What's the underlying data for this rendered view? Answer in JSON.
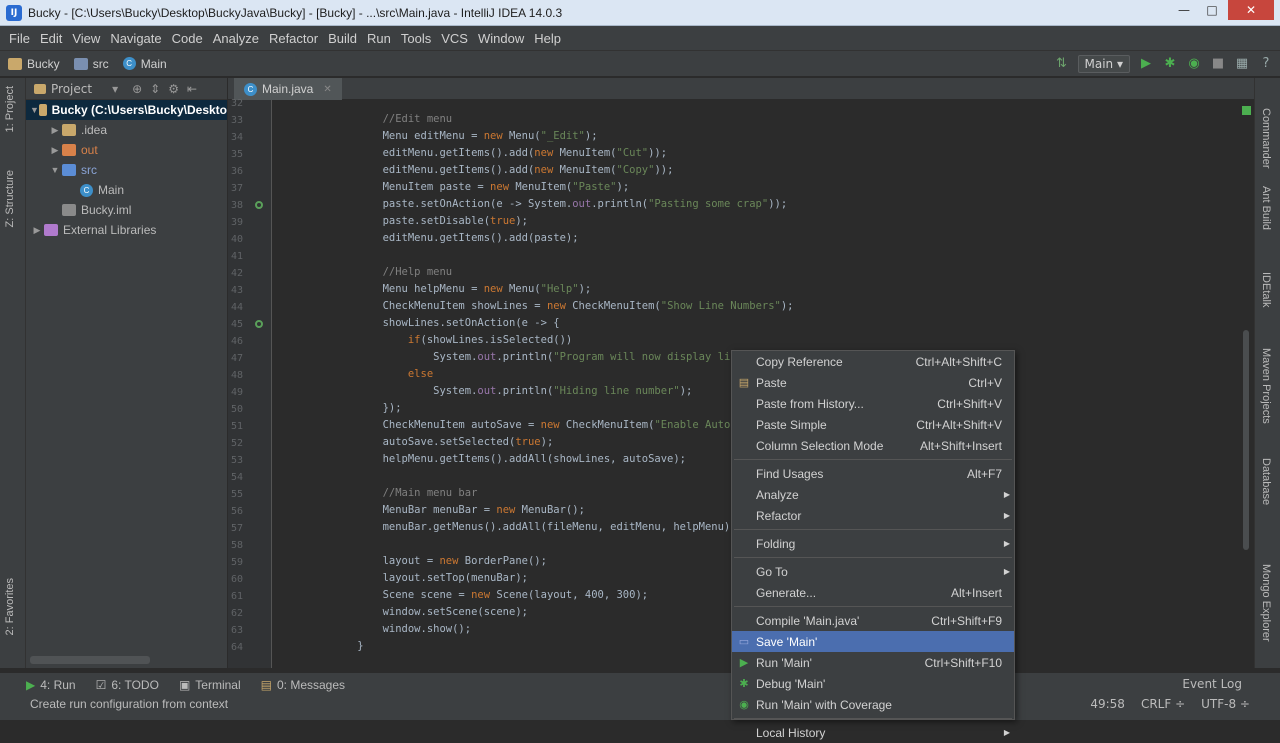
{
  "window": {
    "title": "Bucky - [C:\\Users\\Bucky\\Desktop\\BuckyJava\\Bucky] - [Bucky] - ...\\src\\Main.java - IntelliJ IDEA 14.0.3"
  },
  "menubar": [
    "File",
    "Edit",
    "View",
    "Navigate",
    "Code",
    "Analyze",
    "Refactor",
    "Build",
    "Run",
    "Tools",
    "VCS",
    "Window",
    "Help"
  ],
  "breadcrumbs": [
    "Bucky",
    "src",
    "Main"
  ],
  "run_config": "Main",
  "project_panel": {
    "title": "Project",
    "tree": [
      {
        "label": "Bucky (C:\\Users\\Bucky\\Deskto",
        "indent": 0,
        "arrow": "▼",
        "icon": "module",
        "selected": true
      },
      {
        "label": ".idea",
        "indent": 1,
        "arrow": "▶",
        "icon": "folder"
      },
      {
        "label": "out",
        "indent": 1,
        "arrow": "▶",
        "icon": "folder-orange"
      },
      {
        "label": "src",
        "indent": 1,
        "arrow": "▼",
        "icon": "folder-blue"
      },
      {
        "label": "Main",
        "indent": 2,
        "arrow": "",
        "icon": "class"
      },
      {
        "label": "Bucky.iml",
        "indent": 1,
        "arrow": "",
        "icon": "file"
      },
      {
        "label": "External Libraries",
        "indent": 0,
        "arrow": "▶",
        "icon": "library"
      }
    ]
  },
  "left_tabs": [
    "1: Project",
    "Z: Structure",
    "2: Favorites"
  ],
  "right_tabs": [
    "Commander",
    "Ant Build",
    "IDEtalk",
    "Maven Projects",
    "Database",
    "Mongo Explorer"
  ],
  "editor": {
    "tab": "Main.java",
    "first_line": 32,
    "lines": [
      [],
      [
        [
          "cm",
          "        //Edit menu"
        ]
      ],
      [
        [
          "",
          "        Menu editMenu = "
        ],
        [
          "kw",
          "new "
        ],
        [
          "",
          "Menu("
        ],
        [
          "str",
          "\"_Edit\""
        ],
        [
          "",
          ");"
        ]
      ],
      [
        [
          "",
          "        editMenu.getItems().add("
        ],
        [
          "kw",
          "new "
        ],
        [
          "",
          "MenuItem("
        ],
        [
          "str",
          "\"Cut\""
        ],
        [
          "",
          "));"
        ]
      ],
      [
        [
          "",
          "        editMenu.getItems().add("
        ],
        [
          "kw",
          "new "
        ],
        [
          "",
          "MenuItem("
        ],
        [
          "str",
          "\"Copy\""
        ],
        [
          "",
          "));"
        ]
      ],
      [
        [
          "",
          "        MenuItem paste = "
        ],
        [
          "kw",
          "new "
        ],
        [
          "",
          "MenuItem("
        ],
        [
          "str",
          "\"Paste\""
        ],
        [
          "",
          ");"
        ]
      ],
      [
        [
          "",
          "        paste.setOnAction(e -> System."
        ],
        [
          "fld",
          "out"
        ],
        [
          "",
          ".println("
        ],
        [
          "str",
          "\"Pasting some crap\""
        ],
        [
          "",
          "));"
        ]
      ],
      [
        [
          "",
          "        paste.setDisable("
        ],
        [
          "kw",
          "true"
        ],
        [
          "",
          ");"
        ]
      ],
      [
        [
          "",
          "        editMenu.getItems().add(paste);"
        ]
      ],
      [],
      [
        [
          "cm",
          "        //Help menu"
        ]
      ],
      [
        [
          "",
          "        Menu helpMenu = "
        ],
        [
          "kw",
          "new "
        ],
        [
          "",
          "Menu("
        ],
        [
          "str",
          "\"Help\""
        ],
        [
          "",
          ");"
        ]
      ],
      [
        [
          "",
          "        CheckMenuItem showLines = "
        ],
        [
          "kw",
          "new "
        ],
        [
          "",
          "CheckMenuItem("
        ],
        [
          "str",
          "\"Show Line Numbers\""
        ],
        [
          "",
          ");"
        ]
      ],
      [
        [
          "",
          "        showLines.setOnAction(e -> {"
        ]
      ],
      [
        [
          "",
          "            "
        ],
        [
          "kw",
          "if"
        ],
        [
          "",
          "(showLines.isSelected())"
        ]
      ],
      [
        [
          "",
          "                System."
        ],
        [
          "fld",
          "out"
        ],
        [
          "",
          ".println("
        ],
        [
          "str",
          "\"Program will now display line"
        ]
      ],
      [
        [
          "",
          "            "
        ],
        [
          "kw",
          "else"
        ]
      ],
      [
        [
          "",
          "                System."
        ],
        [
          "fld",
          "out"
        ],
        [
          "",
          ".println("
        ],
        [
          "str",
          "\"Hiding line number\""
        ],
        [
          "",
          ");"
        ]
      ],
      [
        [
          "",
          "        });"
        ]
      ],
      [
        [
          "",
          "        CheckMenuItem autoSave = "
        ],
        [
          "kw",
          "new "
        ],
        [
          "",
          "CheckMenuItem("
        ],
        [
          "str",
          "\"Enable Autosa"
        ]
      ],
      [
        [
          "",
          "        autoSave.setSelected("
        ],
        [
          "kw",
          "true"
        ],
        [
          "",
          ");"
        ]
      ],
      [
        [
          "",
          "        helpMenu.getItems().addAll(showLines, autoSave);"
        ]
      ],
      [],
      [
        [
          "cm",
          "        //Main menu bar"
        ]
      ],
      [
        [
          "",
          "        MenuBar menuBar = "
        ],
        [
          "kw",
          "new "
        ],
        [
          "",
          "MenuBar();"
        ]
      ],
      [
        [
          "",
          "        menuBar.getMenus().addAll(fileMenu, editMenu, helpMenu);"
        ]
      ],
      [],
      [
        [
          "",
          "        layout = "
        ],
        [
          "kw",
          "new "
        ],
        [
          "",
          "BorderPane();"
        ]
      ],
      [
        [
          "",
          "        layout.setTop(menuBar);"
        ]
      ],
      [
        [
          "",
          "        Scene scene = "
        ],
        [
          "kw",
          "new "
        ],
        [
          "",
          "Scene(layout, 400, 300);"
        ]
      ],
      [
        [
          "",
          "        window.setScene(scene);"
        ]
      ],
      [
        [
          "",
          "        window.show();"
        ]
      ],
      [
        [
          "",
          "    }"
        ]
      ]
    ]
  },
  "context_menu": [
    {
      "label": "Copy Reference",
      "shortcut": "Ctrl+Alt+Shift+C"
    },
    {
      "label": "Paste",
      "shortcut": "Ctrl+V",
      "icon": "paste-icon"
    },
    {
      "label": "Paste from History...",
      "shortcut": "Ctrl+Shift+V"
    },
    {
      "label": "Paste Simple",
      "shortcut": "Ctrl+Alt+Shift+V"
    },
    {
      "label": "Column Selection Mode",
      "shortcut": "Alt+Shift+Insert"
    },
    {
      "sep": true
    },
    {
      "label": "Find Usages",
      "shortcut": "Alt+F7"
    },
    {
      "label": "Analyze",
      "submenu": true
    },
    {
      "label": "Refactor",
      "submenu": true
    },
    {
      "sep": true
    },
    {
      "label": "Folding",
      "submenu": true
    },
    {
      "sep": true
    },
    {
      "label": "Go To",
      "submenu": true
    },
    {
      "label": "Generate...",
      "shortcut": "Alt+Insert"
    },
    {
      "sep": true
    },
    {
      "label": "Compile 'Main.java'",
      "shortcut": "Ctrl+Shift+F9"
    },
    {
      "label": "Save 'Main'",
      "highlighted": true,
      "icon": "save-config-icon"
    },
    {
      "label": "Run 'Main'",
      "shortcut": "Ctrl+Shift+F10",
      "icon": "run-icon"
    },
    {
      "label": "Debug 'Main'",
      "icon": "debug-icon"
    },
    {
      "label": "Run 'Main' with Coverage",
      "icon": "coverage-icon"
    },
    {
      "sep": true
    },
    {
      "label": "Local History",
      "submenu": true
    }
  ],
  "toolwindows": [
    "4: Run",
    "6: TODO",
    "Terminal",
    "0: Messages"
  ],
  "status": {
    "message": "Create run configuration from context",
    "position": "49:58",
    "line_sep": "CRLF ÷",
    "encoding": "UTF-8 ÷",
    "event_log": "Event Log"
  },
  "colors": {
    "accent": "#4b6eaf",
    "background": "#2b2b2b",
    "panel": "#3c3f41"
  }
}
